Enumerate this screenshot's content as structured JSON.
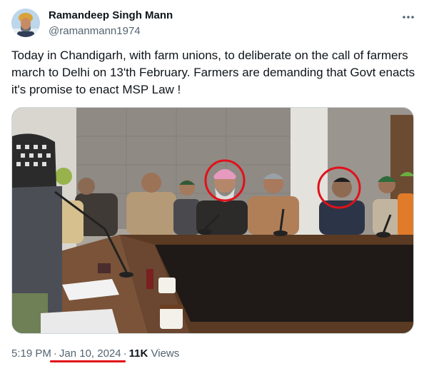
{
  "author": {
    "display_name": "Ramandeep Singh Mann",
    "handle": "@ramanmann1974"
  },
  "tweet": {
    "text": "Today in Chandigarh, with farm unions, to deliberate on the call of farmers march to Delhi on 13'th February. Farmers are demanding that Govt enacts it's promise to enact MSP Law !"
  },
  "meta": {
    "time": "5:19 PM",
    "separator": "·",
    "date": "Jan 10, 2024",
    "views_count": "11K",
    "views_label": "Views"
  },
  "icons": {
    "more": "more-horizontal-icon"
  },
  "colors": {
    "text_primary": "#0f1419",
    "text_secondary": "#536471",
    "annotation_red": "#e0111a"
  }
}
